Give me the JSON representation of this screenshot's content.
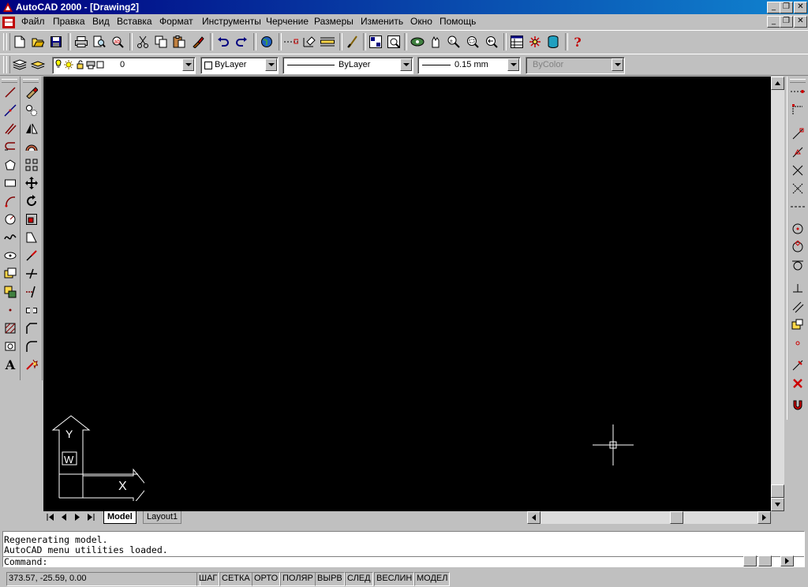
{
  "window": {
    "title": "AutoCAD 2000 - [Drawing2]",
    "minimize_icon": "minimize-icon",
    "restore_icon": "restore-icon",
    "close_icon": "close-icon"
  },
  "menu": {
    "items": [
      {
        "label": "Файл"
      },
      {
        "label": "Правка"
      },
      {
        "label": "Вид"
      },
      {
        "label": "Вставка"
      },
      {
        "label": "Формат"
      },
      {
        "label": "Инструменты"
      },
      {
        "label": "Черчение"
      },
      {
        "label": "Размеры"
      },
      {
        "label": "Изменить"
      },
      {
        "label": "Окно"
      },
      {
        "label": "Помощь"
      }
    ]
  },
  "properties": {
    "layer_value": "0",
    "color_value": "ByLayer",
    "linetype_value": "ByLayer",
    "lineweight_value": "0.15 mm",
    "plotstyle_value": "ByColor"
  },
  "layout_tabs": {
    "model": "Model",
    "layout1": "Layout1"
  },
  "command": {
    "lines": [
      "Regenerating model.",
      "AutoCAD menu utilities loaded."
    ],
    "prompt": "Command:"
  },
  "status": {
    "coords": "373.57, -25.59, 0.00",
    "toggles": [
      "ШАГ",
      "СЕТКА",
      "ОРТО",
      "ПОЛЯР",
      "ВЫРВ",
      "СЛЕД",
      "ВЕСЛИН",
      "МОДЕЛ"
    ]
  },
  "ucs": {
    "y_label": "Y",
    "x_label": "X",
    "w_label": "W"
  },
  "colors": {
    "titlebar": "#000080",
    "canvas": "#000000",
    "chrome": "#c0c0c0"
  }
}
